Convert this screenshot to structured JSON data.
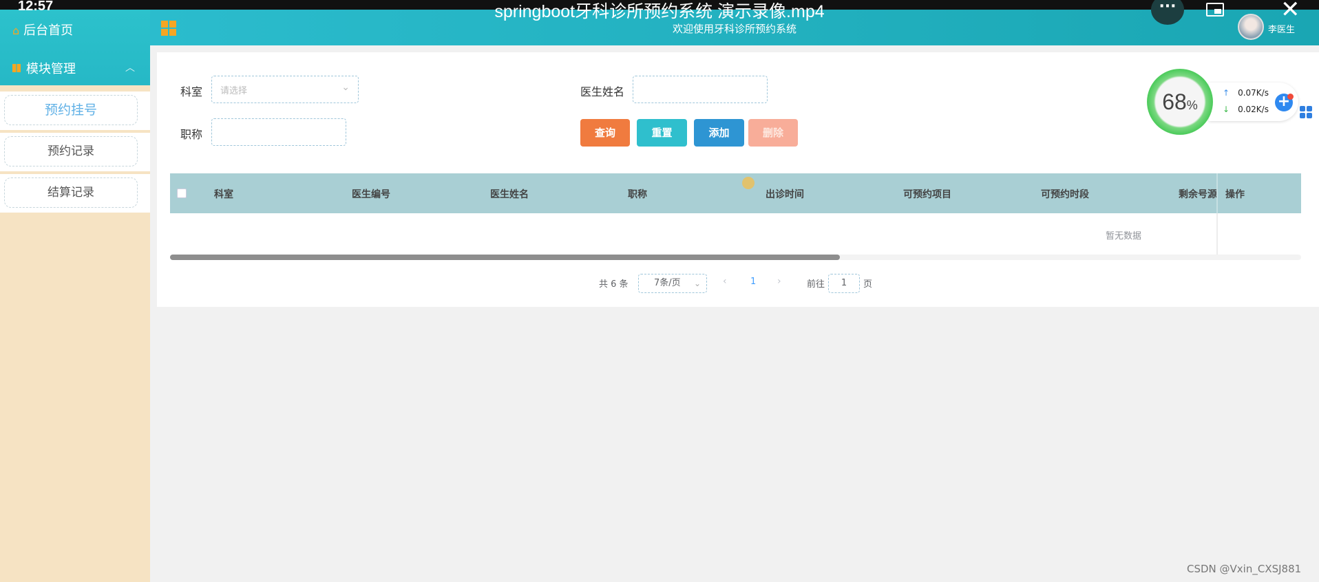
{
  "overlay": {
    "time": "12:57",
    "video_title": "springboot牙科诊所预约系统 演示录像.mp4",
    "more_label": "···",
    "close_label": "✕"
  },
  "header": {
    "welcome": "欢迎使用牙科诊所预约系统",
    "user_name": "李医生"
  },
  "sidebar": {
    "home_label": "后台首页",
    "module_label": "模块管理",
    "items": [
      {
        "label": "预约挂号",
        "active": true
      },
      {
        "label": "预约记录",
        "active": false
      },
      {
        "label": "结算记录",
        "active": false
      }
    ]
  },
  "search": {
    "department_label": "科室",
    "department_placeholder": "请选择",
    "doctor_name_label": "医生姓名",
    "title_label": "职称"
  },
  "buttons": {
    "query": "查询",
    "reset": "重置",
    "add": "添加",
    "delete": "删除"
  },
  "table": {
    "columns": [
      "科室",
      "医生编号",
      "医生姓名",
      "职称",
      "出诊时间",
      "可预约项目",
      "可预约时段",
      "剩余号源",
      "操作"
    ],
    "empty_text": "暂无数据",
    "rows": []
  },
  "pagination": {
    "total_text": "共 6 条",
    "page_size": "7条/页",
    "current_page": "1",
    "goto_label": "前往",
    "goto_value": "1",
    "page_suffix": "页"
  },
  "speed_widget": {
    "percent": "68",
    "percent_unit": "%",
    "upload": "0.07K/s",
    "download": "0.02K/s"
  },
  "watermark": "CSDN @Vxin_CXSJ881",
  "colors": {
    "header": "#2bbccd",
    "sidebar": "#f6e3c3",
    "query": "#f07b3f",
    "reset": "#2fbfcd",
    "add": "#2e95d3",
    "delete": "#f8ad99",
    "table_head": "#a9cfd4"
  }
}
